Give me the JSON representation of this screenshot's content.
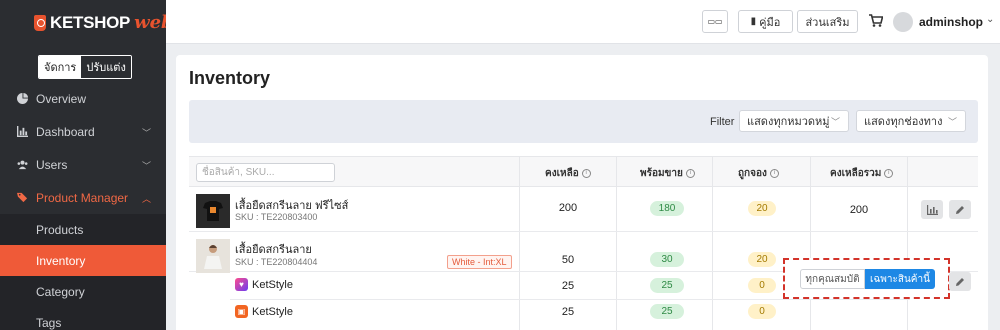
{
  "brand": {
    "name": "KETSHOP",
    "suffix": "web"
  },
  "mode_toggle": {
    "manage": "จัดการ",
    "customize": "ปรับแต่ง"
  },
  "sidebar": {
    "items": [
      {
        "label": "Overview",
        "icon": "pie-chart-icon"
      },
      {
        "label": "Dashboard",
        "icon": "bar-chart-icon"
      },
      {
        "label": "Users",
        "icon": "users-icon"
      },
      {
        "label": "Product Manager",
        "icon": "tag-icon"
      }
    ],
    "sub_items": [
      {
        "label": "Products"
      },
      {
        "label": "Inventory"
      },
      {
        "label": "Category"
      },
      {
        "label": "Tags"
      }
    ]
  },
  "topbar": {
    "btn_grid": "▭▭",
    "btn_manual": "คู่มือ",
    "btn_addons": "ส่วนเสริม",
    "user_name": "adminshop"
  },
  "page": {
    "title": "Inventory",
    "filter_label": "Filter",
    "filter_category": "แสดงทุกหมวดหมู่",
    "filter_channel": "แสดงทุกช่องทาง"
  },
  "table": {
    "search_placeholder": "ชื่อสินค้า, SKU...",
    "headers": {
      "remaining": "คงเหลือ",
      "ready": "พร้อมขาย",
      "reserved": "ถูกจอง",
      "total": "คงเหลือรวม"
    },
    "rows": [
      {
        "name": "เสื้อยืดสกรีนลาย ฟรีไซส์",
        "sku": "SKU : TE220803400",
        "remaining": "200",
        "ready": "180",
        "reserved": "20",
        "total": "200"
      },
      {
        "name": "เสื้อยืดสกรีนลาย",
        "sku": "SKU : TE220804404",
        "variant": "White - Int:XL",
        "remaining": "50",
        "ready": "30",
        "reserved": "20"
      }
    ],
    "channels": [
      {
        "name": "KetStyle",
        "remaining": "25",
        "ready": "25",
        "reserved": "0"
      },
      {
        "name": "KetStyle",
        "remaining": "25",
        "ready": "25",
        "reserved": "0"
      }
    ]
  },
  "popover": {
    "all_attributes": "ทุกคุณสมบัติ",
    "product_only": "เฉพาะสินค้านี้"
  },
  "colors": {
    "accent": "#ef5a38",
    "sidebar_bg": "#2b2d31",
    "primary_blue": "#1e88e5"
  }
}
